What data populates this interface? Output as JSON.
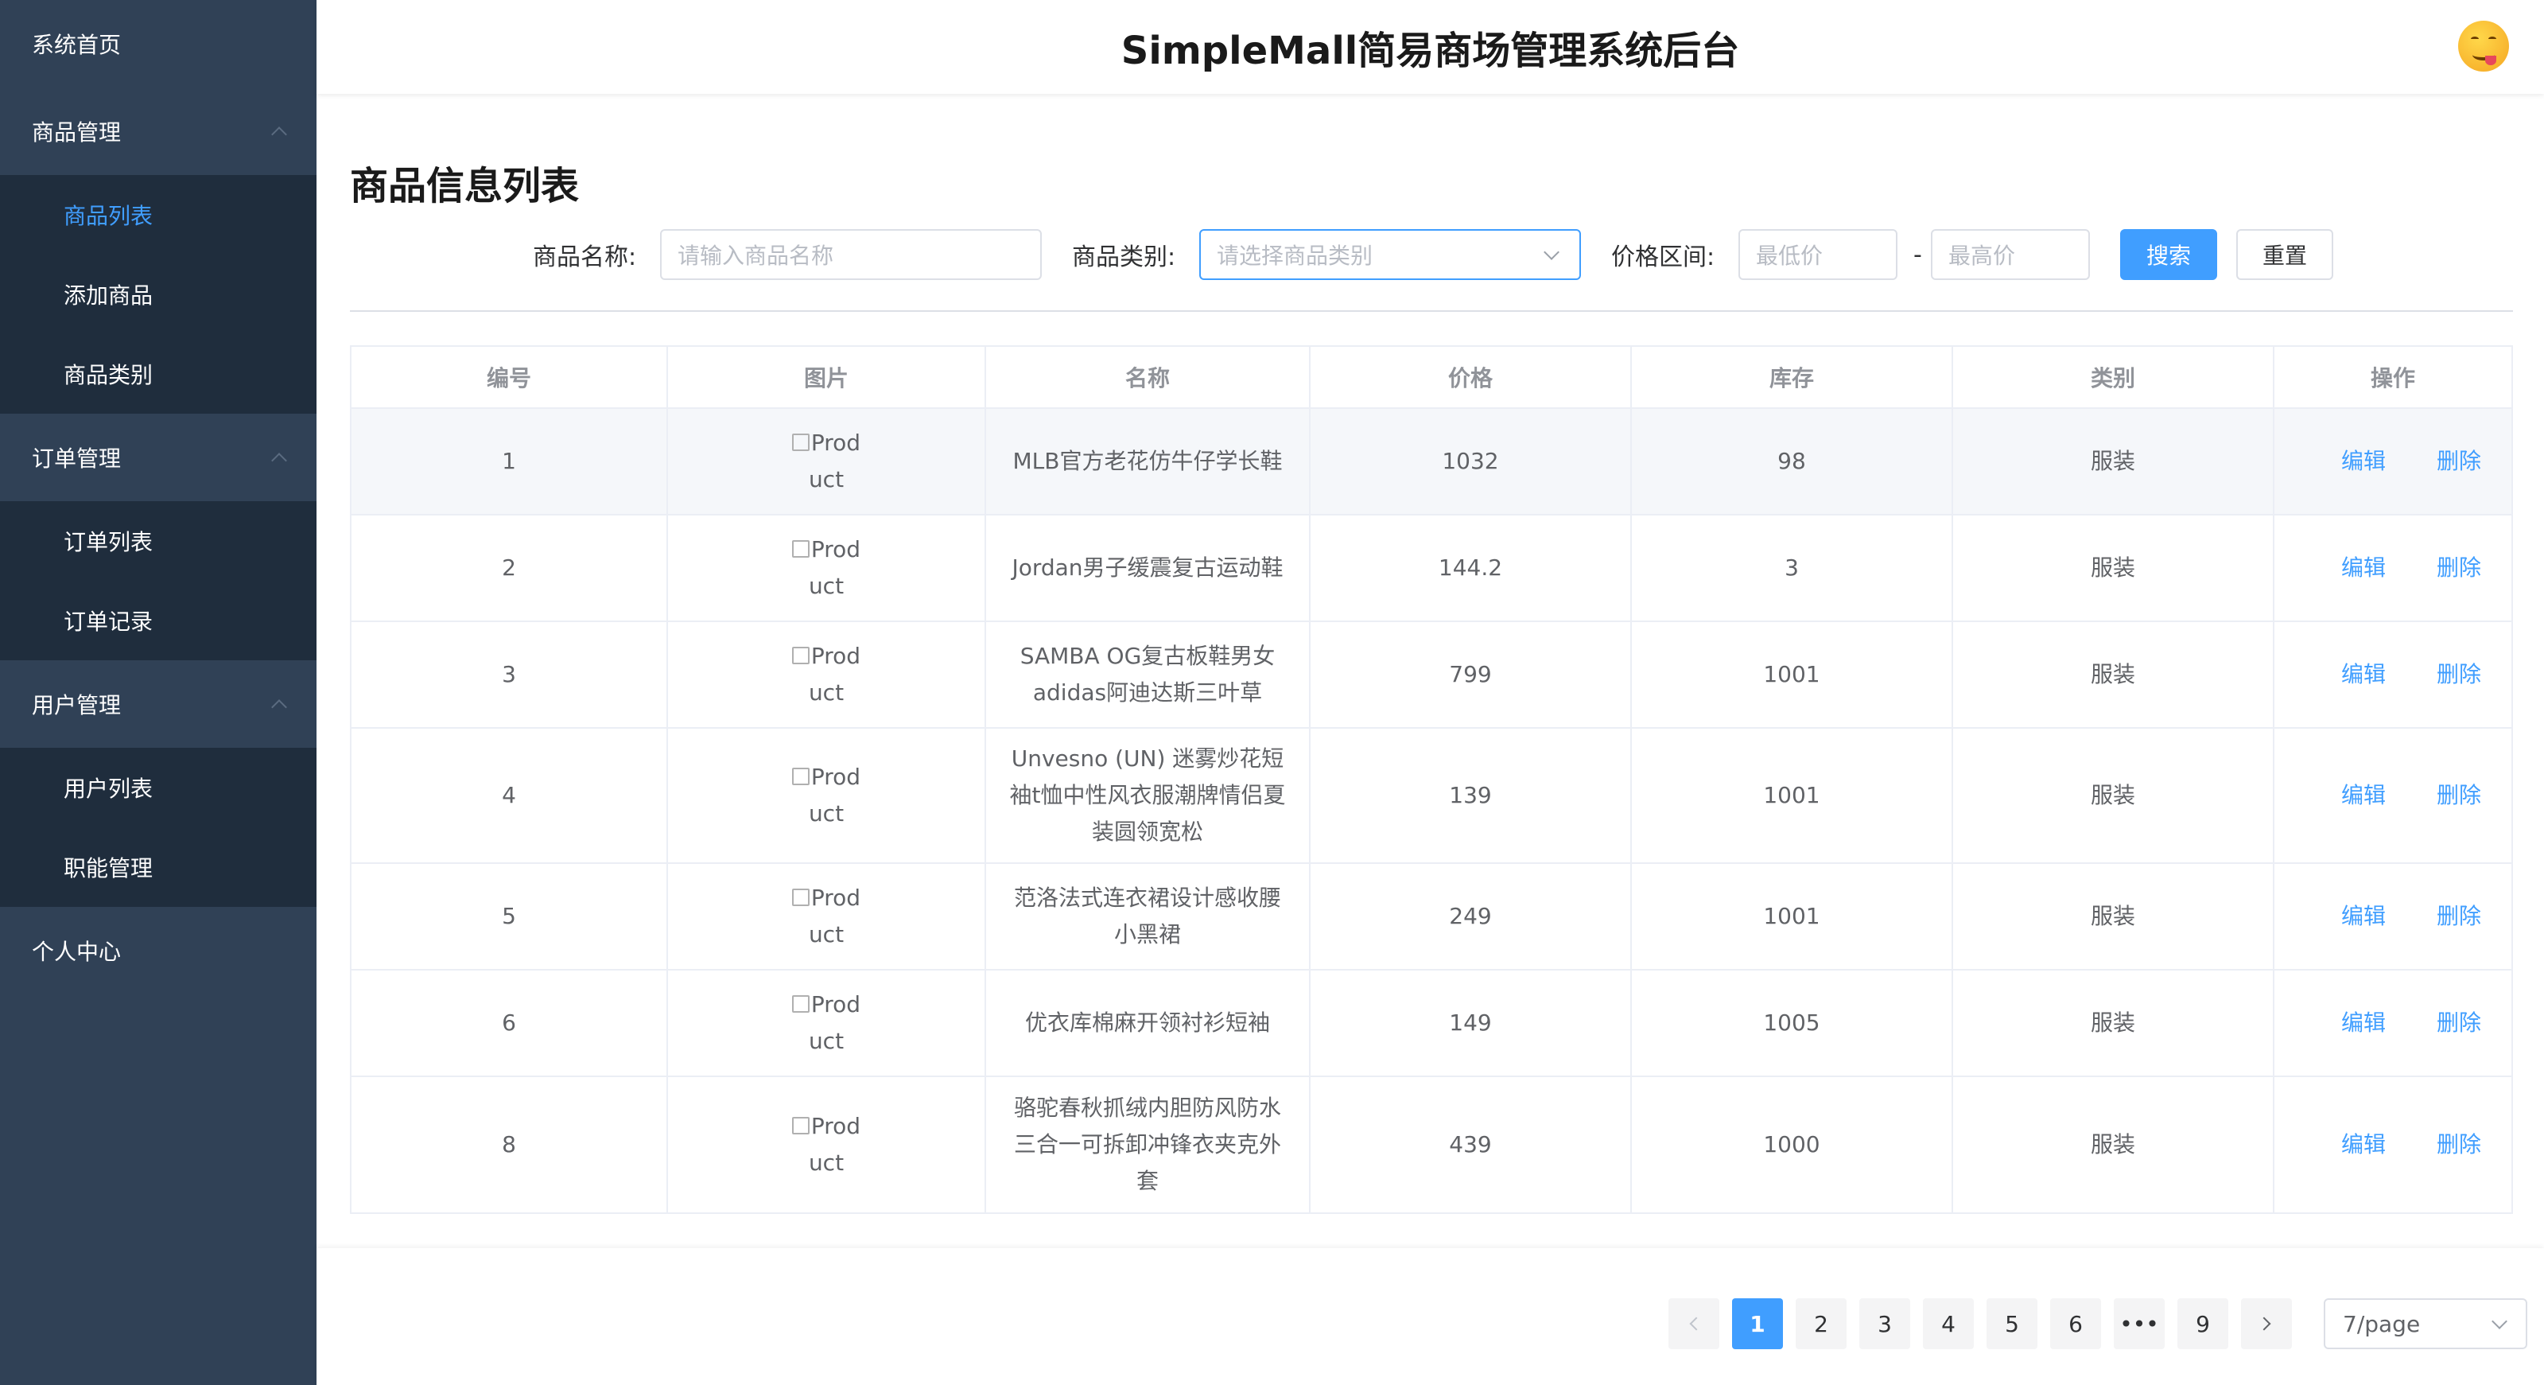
{
  "header": {
    "title": "SimpleMall简易商场管理系统后台"
  },
  "sidebar": {
    "home": "系统首页",
    "groups": [
      {
        "label": "商品管理",
        "items": [
          "商品列表",
          "添加商品",
          "商品类别"
        ]
      },
      {
        "label": "订单管理",
        "items": [
          "订单列表",
          "订单记录"
        ]
      },
      {
        "label": "用户管理",
        "items": [
          "用户列表",
          "职能管理"
        ]
      }
    ],
    "personal": "个人中心",
    "active_item": "商品列表"
  },
  "main": {
    "page_title": "商品信息列表",
    "filters": {
      "name_label": "商品名称:",
      "name_placeholder": "请输入商品名称",
      "category_label": "商品类别:",
      "category_placeholder": "请选择商品类别",
      "price_label": "价格区间:",
      "min_placeholder": "最低价",
      "separator": "-",
      "max_placeholder": "最高价",
      "search_button": "搜索",
      "reset_button": "重置"
    },
    "table": {
      "columns": [
        "编号",
        "图片",
        "名称",
        "价格",
        "库存",
        "类别",
        "操作"
      ],
      "image_alt": "Product",
      "edit_label": "编辑",
      "delete_label": "删除",
      "rows": [
        {
          "id": "1",
          "name": "MLB官方老花仿牛仔学长鞋",
          "price": "1032",
          "stock": "98",
          "category": "服装"
        },
        {
          "id": "2",
          "name": "Jordan男子缓震复古运动鞋",
          "price": "144.2",
          "stock": "3",
          "category": "服装"
        },
        {
          "id": "3",
          "name": "SAMBA OG复古板鞋男女adidas阿迪达斯三叶草",
          "price": "799",
          "stock": "1001",
          "category": "服装"
        },
        {
          "id": "4",
          "name": "Unvesno (UN) 迷雾炒花短袖t恤中性风衣服潮牌情侣夏装圆领宽松",
          "price": "139",
          "stock": "1001",
          "category": "服装"
        },
        {
          "id": "5",
          "name": "范洛法式连衣裙设计感收腰小黑裙",
          "price": "249",
          "stock": "1001",
          "category": "服装"
        },
        {
          "id": "6",
          "name": "优衣库棉麻开领衬衫短袖",
          "price": "149",
          "stock": "1005",
          "category": "服装"
        },
        {
          "id": "8",
          "name": "骆驼春秋抓绒内胆防风防水三合一可拆卸冲锋衣夹克外套",
          "price": "439",
          "stock": "1000",
          "category": "服装"
        }
      ]
    }
  },
  "pagination": {
    "pages": [
      "1",
      "2",
      "3",
      "4",
      "5",
      "6",
      "•••",
      "9"
    ],
    "current": "1",
    "page_size": "7/page"
  },
  "colors": {
    "sidebar_bg": "#304156",
    "submenu_bg": "#1f2d3d",
    "accent": "#409eff"
  }
}
